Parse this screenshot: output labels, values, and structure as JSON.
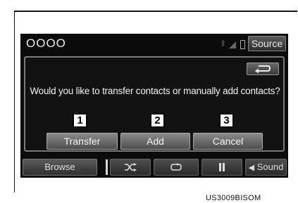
{
  "header": {
    "title": "OOOO",
    "source_label": "Source",
    "icons": [
      "bluetooth-icon",
      "signal-icon",
      "phone-battery-icon"
    ]
  },
  "dialog": {
    "question": "Would you like to transfer contacts or manually add contacts?",
    "back_icon": "back-arrow-icon",
    "buttons": [
      {
        "label": "Transfer",
        "marker": "1"
      },
      {
        "label": "Add",
        "marker": "2"
      },
      {
        "label": "Cancel",
        "marker": "3"
      }
    ]
  },
  "bottom_bar": {
    "browse_label": "Browse",
    "shuffle_icon": "shuffle-icon",
    "repeat_icon": "repeat-icon",
    "pause_icon": "pause-icon",
    "sound_label": "Sound"
  },
  "caption": "US3009BISOM",
  "colors": {
    "screen_bg": "#0b0b0b",
    "button_gradient_top": "#8a8a8a",
    "button_gradient_bottom": "#4e4e4e"
  }
}
